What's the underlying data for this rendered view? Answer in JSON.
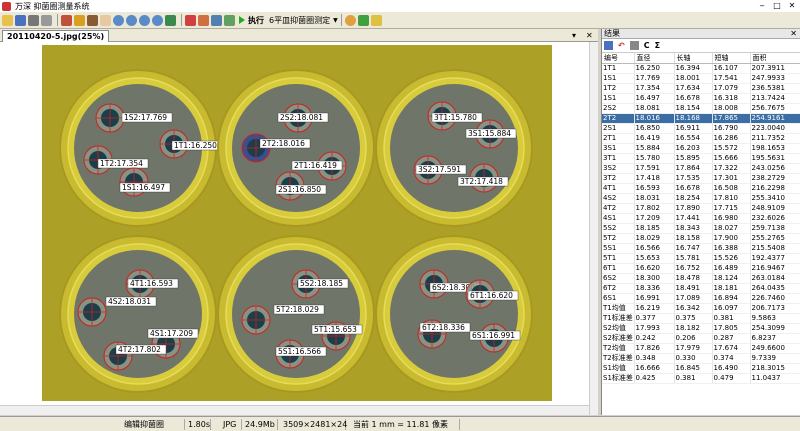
{
  "titlebar": {
    "title": "万深 抑菌圈测量系统"
  },
  "toolbar": {
    "exec_label": "执行",
    "mode_dropdown": "6平皿抑菌圈测定",
    "icons": [
      "open-icon",
      "save-icon",
      "camera-icon",
      "print-icon",
      "edit-icon",
      "pencil-icon",
      "brush-icon",
      "hand-icon",
      "zoom-in-icon",
      "zoom-out-icon",
      "zoom-fit-icon",
      "zoom-actual-icon",
      "grid-icon",
      "flag-icon",
      "flag2-icon",
      "swap-icon",
      "image-icon",
      "check-icon",
      "help-icon"
    ]
  },
  "document": {
    "tab_label": "20110420-5.jpg(25%)"
  },
  "colors": {
    "plate_fill": "#b0a21e",
    "ring": "#d8cc3c",
    "agar": "#6f7568",
    "inhibition": "#8c9a8a",
    "well": "#1c3d4a",
    "marker": "#d02020",
    "selected_row": "#3a6ea5"
  },
  "plates": [
    {
      "labels": [
        "1S2:17.769",
        "1T2:17.354",
        "1T1:16.250",
        "1S1:16.497"
      ]
    },
    {
      "labels": [
        "2S2:18.081",
        "2T2:18.016",
        "2T1:16.419",
        "2S1:16.850"
      ]
    },
    {
      "labels": [
        "3T1:15.780",
        "3S1:15.884",
        "3S2:17.591",
        "3T2:17.418"
      ]
    },
    {
      "labels": [
        "4T1:16.593",
        "4S2:18.031",
        "4S1:17.209",
        "4T2:17.802"
      ]
    },
    {
      "labels": [
        "5S2:18.185",
        "5T2:18.029",
        "5T1:15.653",
        "5S1:16.566"
      ]
    },
    {
      "labels": [
        "6S2:18.300",
        "6T1:16.620",
        "6T2:18.336",
        "6S1:16.991"
      ]
    }
  ],
  "results": {
    "title": "结果",
    "tools": [
      "C",
      "Σ"
    ],
    "columns": [
      "编号",
      "直径",
      "长轴",
      "短轴",
      "面积"
    ],
    "rows": [
      [
        "1T1",
        "16.250",
        "16.394",
        "16.107",
        "207.3911"
      ],
      [
        "1S1",
        "17.769",
        "18.001",
        "17.541",
        "247.9933"
      ],
      [
        "1T2",
        "17.354",
        "17.634",
        "17.079",
        "236.5381"
      ],
      [
        "1S1",
        "16.497",
        "16.678",
        "16.318",
        "213.7424"
      ],
      [
        "2S2",
        "18.081",
        "18.154",
        "18.008",
        "256.7675"
      ],
      [
        "2T2",
        "18.016",
        "18.168",
        "17.865",
        "254.9161"
      ],
      [
        "2S1",
        "16.850",
        "16.911",
        "16.790",
        "223.0040"
      ],
      [
        "2T1",
        "16.419",
        "16.554",
        "16.286",
        "211.7352"
      ],
      [
        "3S1",
        "15.884",
        "16.203",
        "15.572",
        "198.1653"
      ],
      [
        "3T1",
        "15.780",
        "15.895",
        "15.666",
        "195.5631"
      ],
      [
        "3S2",
        "17.591",
        "17.864",
        "17.322",
        "243.0256"
      ],
      [
        "3T2",
        "17.418",
        "17.535",
        "17.301",
        "238.2729"
      ],
      [
        "4T1",
        "16.593",
        "16.678",
        "16.508",
        "216.2298"
      ],
      [
        "4S2",
        "18.031",
        "18.254",
        "17.810",
        "255.3410"
      ],
      [
        "4T2",
        "17.802",
        "17.890",
        "17.715",
        "248.9109"
      ],
      [
        "4S1",
        "17.209",
        "17.441",
        "16.980",
        "232.6026"
      ],
      [
        "5S2",
        "18.185",
        "18.343",
        "18.027",
        "259.7138"
      ],
      [
        "5T2",
        "18.029",
        "18.158",
        "17.900",
        "255.2765"
      ],
      [
        "5S1",
        "16.566",
        "16.747",
        "16.388",
        "215.5408"
      ],
      [
        "5T1",
        "15.653",
        "15.781",
        "15.526",
        "192.4377"
      ],
      [
        "6T1",
        "16.620",
        "16.752",
        "16.489",
        "216.9467"
      ],
      [
        "6S2",
        "18.300",
        "18.478",
        "18.124",
        "263.0184"
      ],
      [
        "6T2",
        "18.336",
        "18.491",
        "18.181",
        "264.0435"
      ],
      [
        "6S1",
        "16.991",
        "17.089",
        "16.894",
        "226.7460"
      ],
      [
        "T1均值",
        "16.219",
        "16.342",
        "16.097",
        "206.7173"
      ],
      [
        "T1标准差",
        "0.377",
        "0.375",
        "0.381",
        "9.5863"
      ],
      [
        "S2均值",
        "17.993",
        "18.182",
        "17.805",
        "254.3099"
      ],
      [
        "S2标准差",
        "0.242",
        "0.206",
        "0.287",
        "6.8237"
      ],
      [
        "T2均值",
        "17.826",
        "17.979",
        "17.674",
        "249.6600"
      ],
      [
        "T2标准差",
        "0.348",
        "0.330",
        "0.374",
        "9.7339"
      ],
      [
        "S1均值",
        "16.666",
        "16.845",
        "16.490",
        "218.3015"
      ],
      [
        "S1标准差",
        "0.425",
        "0.381",
        "0.479",
        "11.0437"
      ]
    ],
    "selected_index": 5
  },
  "status": {
    "mode": "编辑抑菌圈",
    "time": "1.80s",
    "format": "JPG",
    "filesize": "24.9Mb",
    "dimensions": "3509×2481×24",
    "scale": "当前 1 mm = 11.81 像素"
  }
}
